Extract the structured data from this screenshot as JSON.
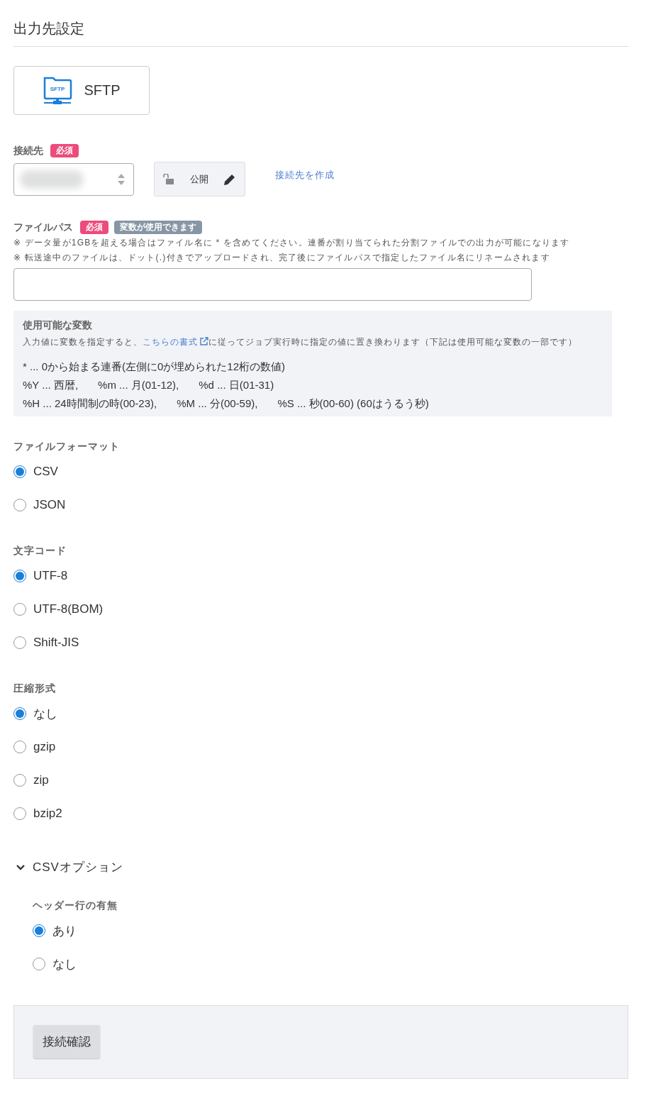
{
  "title": "出力先設定",
  "destination": {
    "label": "SFTP",
    "icon_text": "SFTP"
  },
  "connection": {
    "label": "接続先",
    "required_badge": "必須",
    "visibility": "公開",
    "create_link": "接続先を作成"
  },
  "file_path": {
    "label": "ファイルパス",
    "required_badge": "必須",
    "variables_badge": "変数が使用できます",
    "notes": [
      "※ データ量が1GBを超える場合はファイル名に * を含めてください。連番が割り当てられた分割ファイルでの出力が可能になります",
      "※ 転送途中のファイルは、ドット(.)付きでアップロードされ、完了後にファイルパスで指定したファイル名にリネームされます"
    ]
  },
  "variables_help": {
    "title": "使用可能な変数",
    "description_before": "入力値に変数を指定すると、",
    "link": "こちらの書式",
    "description_after": "に従ってジョブ実行時に指定の値に置き換わります（下記は使用可能な変数の一部です）",
    "lines": [
      [
        "* ... 0から始まる連番(左側に0が埋められた12桁の数値)"
      ],
      [
        "%Y ... 西暦,",
        "%m ... 月(01-12),",
        "%d ... 日(01-31)"
      ],
      [
        "%H ... 24時間制の時(00-23),",
        "%M ... 分(00-59),",
        "%S ... 秒(00-60) (60はうるう秒)"
      ]
    ]
  },
  "radio_groups": [
    {
      "label": "ファイルフォーマット",
      "options": [
        {
          "label": "CSV",
          "selected": true
        },
        {
          "label": "JSON",
          "selected": false
        }
      ]
    },
    {
      "label": "文字コード",
      "options": [
        {
          "label": "UTF-8",
          "selected": true
        },
        {
          "label": "UTF-8(BOM)",
          "selected": false
        },
        {
          "label": "Shift-JIS",
          "selected": false
        }
      ]
    },
    {
      "label": "圧縮形式",
      "options": [
        {
          "label": "なし",
          "selected": true
        },
        {
          "label": "gzip",
          "selected": false
        },
        {
          "label": "zip",
          "selected": false
        },
        {
          "label": "bzip2",
          "selected": false
        }
      ]
    }
  ],
  "csv_options": {
    "label": "CSVオプション",
    "expanded": true,
    "groups": [
      {
        "label": "ヘッダー行の有無",
        "options": [
          {
            "label": "あり",
            "selected": true
          },
          {
            "label": "なし",
            "selected": false
          }
        ]
      }
    ]
  },
  "footer": {
    "button": "接続確認"
  }
}
